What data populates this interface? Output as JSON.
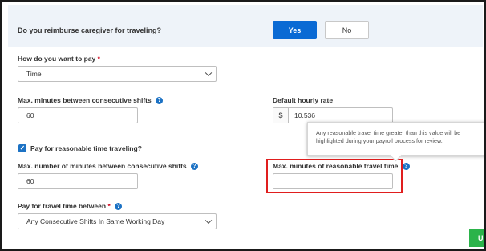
{
  "reimburse": {
    "question": "Do you reimburse caregiver for traveling?",
    "yes_label": "Yes",
    "no_label": "No"
  },
  "pay_method": {
    "label": "How do you want to pay",
    "required_mark": "*",
    "value": "Time"
  },
  "max_minutes_shifts": {
    "label": "Max. minutes between consecutive shifts",
    "value": "60"
  },
  "hourly_rate": {
    "label": "Default hourly rate",
    "currency": "$",
    "value": "10.536"
  },
  "pay_reasonable": {
    "label": "Pay for reasonable time traveling?",
    "checked": true
  },
  "max_number_minutes": {
    "label": "Max. number of minutes between consecutive shifts",
    "value": "60"
  },
  "max_reasonable": {
    "label": "Max. minutes of reasonable travel time",
    "value": ""
  },
  "tooltip": {
    "text": "Any reasonable travel time greater than this value will be highlighted during your payroll process for review.",
    "close": "×"
  },
  "travel_between": {
    "label": "Pay for travel time between",
    "required_mark": "*",
    "value": "Any Consecutive Shifts In Same Working Day"
  },
  "action_button": {
    "label": "Up"
  },
  "colors": {
    "primary": "#0a6ad4",
    "highlight": "#e01e1e",
    "success": "#2bb34a"
  }
}
